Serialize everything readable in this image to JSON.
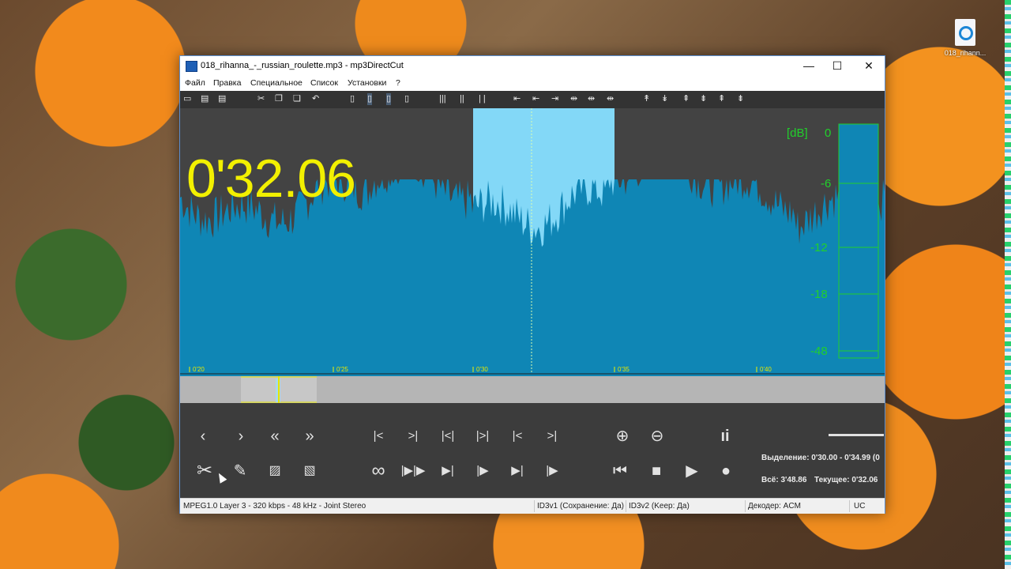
{
  "desktop": {
    "icon_label": "018_rihann..."
  },
  "window": {
    "title": "018_rihanna_-_russian_roulette.mp3 - mp3DirectCut",
    "minimize": "—",
    "maximize": "☐",
    "close": "✕"
  },
  "menu": [
    "Файл",
    "Правка",
    "Специальное",
    "Список",
    "Установки",
    "?"
  ],
  "waveform": {
    "current_time_big": "0'32.06",
    "db_unit": "[dB]",
    "db_levels": [
      "0",
      "-6",
      "-12",
      "-18",
      "-48"
    ],
    "time_ticks": [
      "0'20",
      "0'25",
      "0'30",
      "0'35",
      "0'40"
    ],
    "colors": {
      "wave": "#0f86b5",
      "selection": "#83d8f7",
      "level": "#21d02b",
      "time": "#f2f000"
    }
  },
  "info": {
    "selection": "Выделение: 0'30.00 - 0'34.99 (0",
    "total": "Всё: 3'48.86",
    "current": "Текущее: 0'32.06"
  },
  "status": {
    "format": "MPEG1.0 Layer 3 - 320 kbps - 48 kHz - Joint Stereo",
    "id3v1": "ID3v1 (Сохранение: Да)",
    "id3v2": "ID3v2 (Keep: Да)",
    "decoder": "Декодер: ACM",
    "mode": "UC"
  },
  "icons": {
    "prev": "‹",
    "next": "›",
    "rewind": "«",
    "forward": "»",
    "cut": "✂",
    "edit": "✎",
    "loop": "∞",
    "zoom_in": "⊕",
    "zoom_out": "⊖",
    "go_start": "⏮",
    "stop": "■",
    "play": "▶",
    "record": "●"
  }
}
